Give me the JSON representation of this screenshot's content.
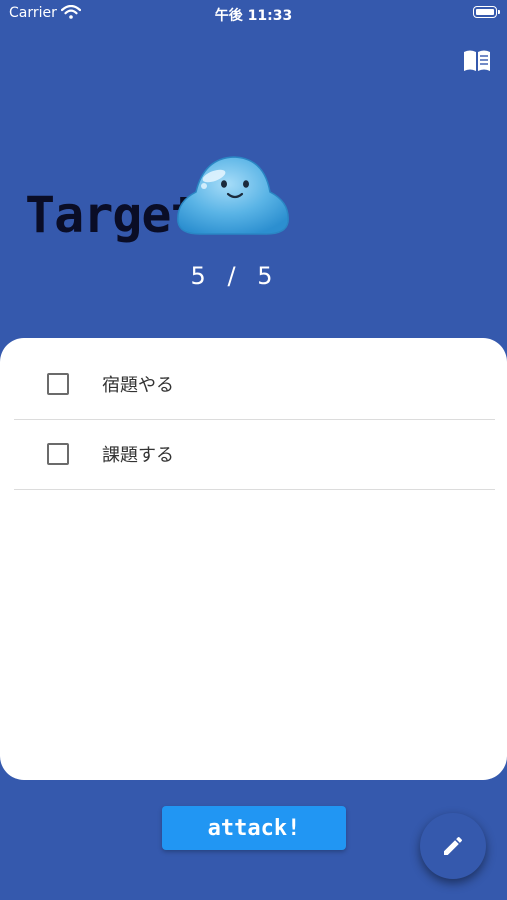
{
  "status_bar": {
    "carrier": "Carrier",
    "time": "午後 11:33",
    "wifi_icon": "wifi-icon",
    "battery_icon": "battery-icon"
  },
  "header": {
    "guide_icon": "book-icon",
    "title": "Target",
    "monster_icon": "slime-icon"
  },
  "hp": {
    "current": "5",
    "separator": "/",
    "total": "5"
  },
  "tasks": [
    {
      "label": "宿題やる",
      "checked": false
    },
    {
      "label": "課題する",
      "checked": false
    }
  ],
  "actions": {
    "attack_label": "attack!",
    "edit_icon": "pencil-icon"
  },
  "colors": {
    "background": "#3559ad",
    "attack_button": "#2196f3",
    "panel": "#ffffff"
  }
}
